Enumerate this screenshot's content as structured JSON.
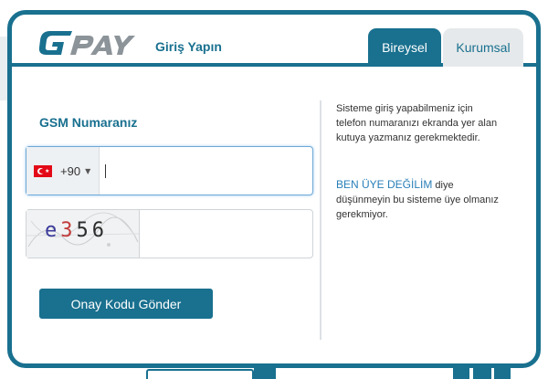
{
  "header": {
    "logo_text": "GPAY",
    "title": "Giriş Yapın"
  },
  "tabs": [
    {
      "label": "Bireysel",
      "active": true
    },
    {
      "label": "Kurumsal",
      "active": false
    }
  ],
  "form": {
    "title": "GSM Numaranız",
    "phone": {
      "country_flag": "turkey-flag-icon",
      "dial_code": "+90",
      "value": "",
      "placeholder": ""
    },
    "captcha": {
      "chars": [
        "e",
        "3",
        "5",
        "6"
      ],
      "value": ""
    },
    "submit_label": "Onay Kodu Gönder"
  },
  "info": {
    "paragraph1": "Sisteme giriş yapabilmeniz için telefon numaranızı ekranda yer alan kutuya yazmanız gerekmektedir.",
    "highlight": "BEN ÜYE DEĞİLİM",
    "paragraph2_rest": " diye düşünmeyin bu sisteme üye olmanız gerekmiyor."
  },
  "colors": {
    "primary": "#19708f",
    "tab_inactive_bg": "#e6e9eb",
    "link_blue": "#2a7fb8",
    "flag_red": "#e30a17"
  }
}
